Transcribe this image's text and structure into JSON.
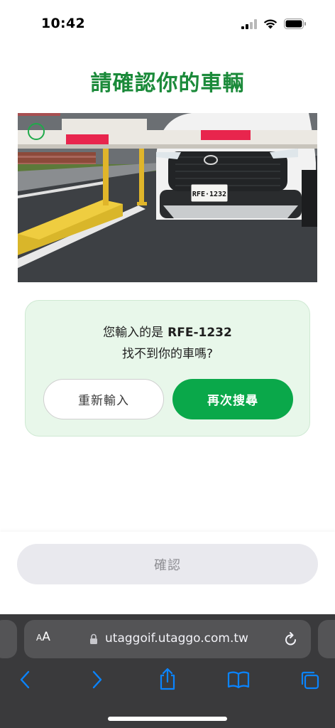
{
  "status_bar": {
    "time": "10:42"
  },
  "page": {
    "title": "請確認你的車輛"
  },
  "photo": {
    "plate_text": "RFE·1232"
  },
  "result": {
    "prefix": "您輸入的是",
    "plate": "RFE-1232",
    "question": "找不到你的車嗎?",
    "reenter_label": "重新輸入",
    "search_again_label": "再次搜尋"
  },
  "footer": {
    "confirm_label": "確認"
  },
  "browser": {
    "aa_small": "A",
    "aa_large": "A",
    "url": "utaggoif.utaggo.com.tw"
  },
  "colors": {
    "brand_green": "#0aa84a",
    "title_green": "#1b8a3a",
    "card_bg": "#e8f7ea",
    "browser_bg": "#3a3a3c",
    "ios_blue": "#0a84ff"
  }
}
